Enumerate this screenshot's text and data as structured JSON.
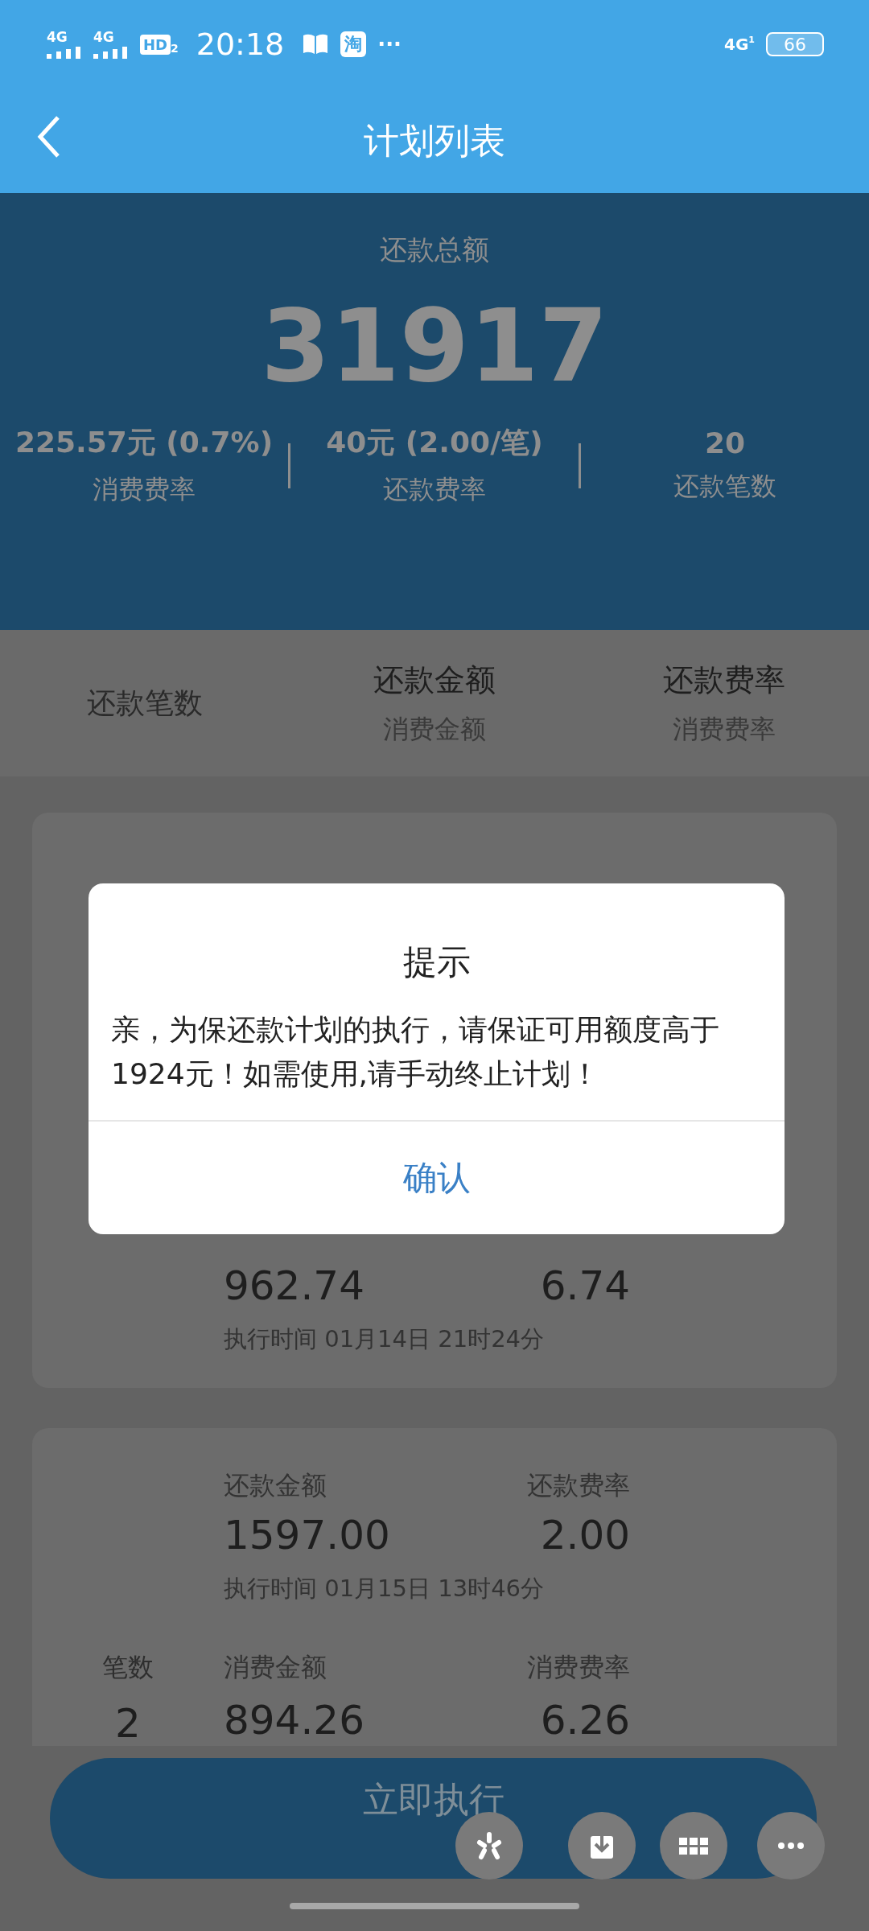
{
  "status_bar": {
    "network_labels": [
      "4G",
      "4G"
    ],
    "hd": "HD",
    "hd_sub": "2",
    "time": "20:18",
    "app_badge": "淘",
    "more": "···",
    "right_network": "4G",
    "right_network_sub": "1",
    "battery": "66"
  },
  "header": {
    "title": "计划列表"
  },
  "summary": {
    "label": "还款总额",
    "total": "31917",
    "stats": [
      {
        "value": "225.57元 (0.7%)",
        "label": "消费费率"
      },
      {
        "value": "40元 (2.00/笔)",
        "label": "还款费率"
      },
      {
        "value": "20",
        "label": "还款笔数"
      }
    ]
  },
  "table_header": [
    {
      "title": "还款笔数"
    },
    {
      "title": "还款金额",
      "subtitle": "消费金额"
    },
    {
      "title": "还款费率",
      "subtitle": "消费费率"
    }
  ],
  "plans": [
    {
      "sections": [
        {
          "values": [
            "962.74",
            "6.74"
          ],
          "time": "执行时间 01月14日 21时24分"
        }
      ]
    },
    {
      "sections": [
        {
          "labels": [
            "还款金额",
            "还款费率"
          ],
          "values": [
            "1597.00",
            "2.00"
          ],
          "time": "执行时间 01月15日 13时46分"
        },
        {
          "count_label": "笔数",
          "count": "2",
          "labels": [
            "消费金额",
            "消费费率"
          ],
          "values": [
            "894.26",
            "6.26"
          ]
        }
      ]
    }
  ],
  "execute_button": "立即执行",
  "dialog": {
    "title": "提示",
    "message": "亲，为保还款计划的执行，请保证可用额度高于1924元！如需使用,请手动终止计划！",
    "confirm": "确认"
  }
}
